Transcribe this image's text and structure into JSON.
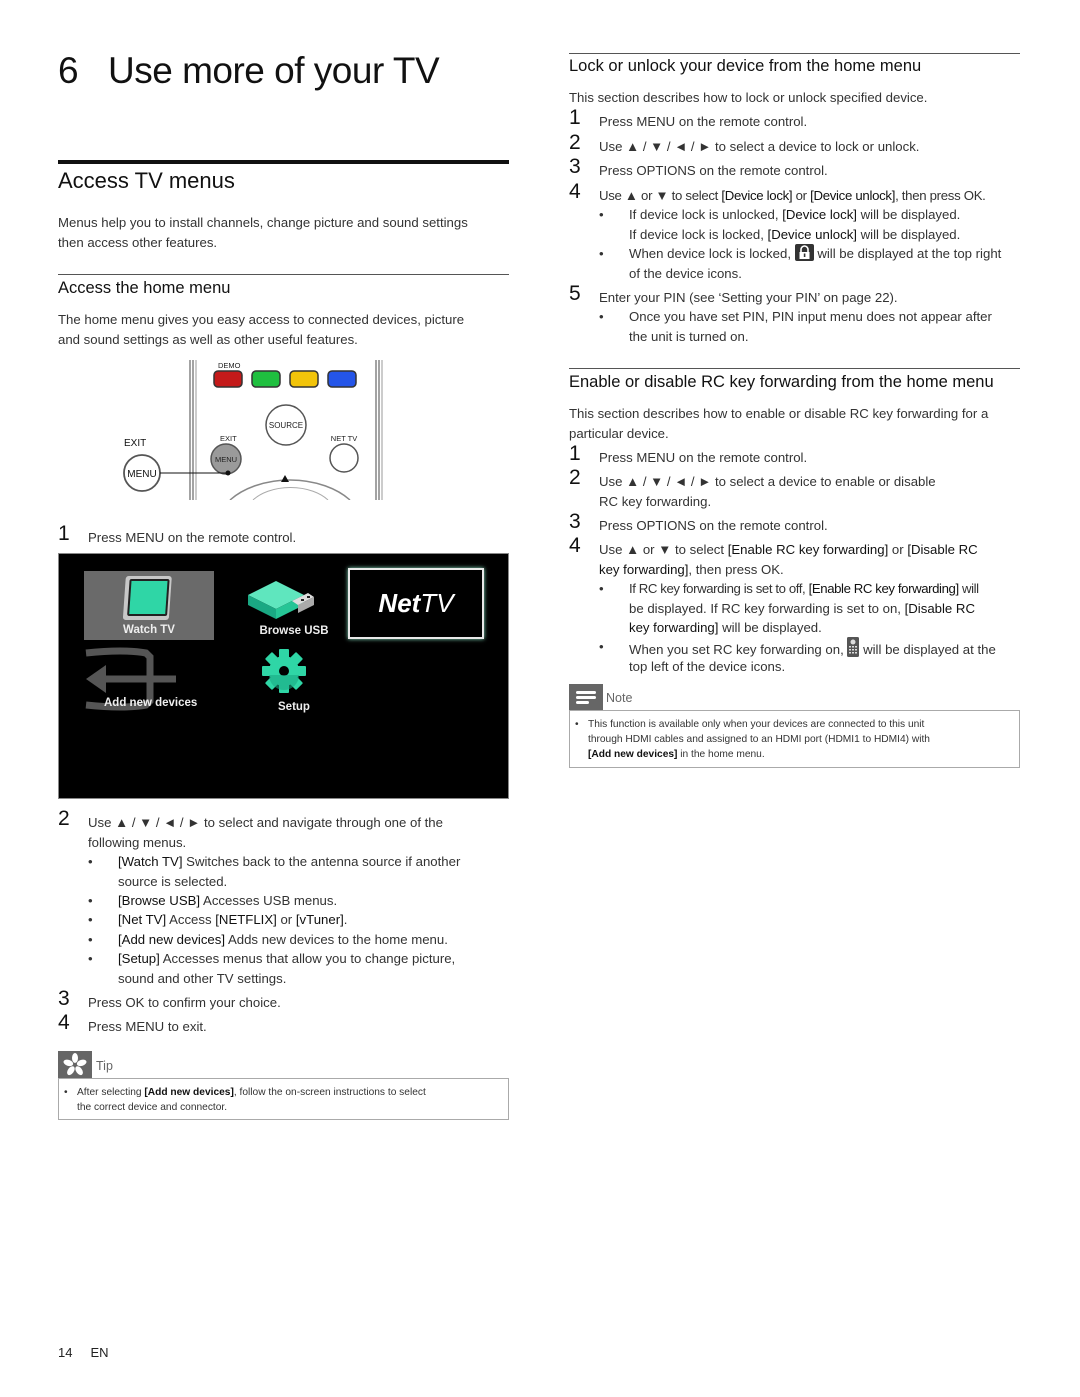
{
  "chapter": {
    "number": "6",
    "title": "Use more of your TV"
  },
  "access_tv_menus": {
    "heading": "Access TV menus",
    "intro": [
      "Menus help you to install channels, change picture and sound settings",
      "then access other features."
    ]
  },
  "access_home_menu": {
    "heading": "Access the home menu",
    "intro": [
      "The home menu gives you easy access to connected devices, picture",
      "and sound settings as well as other useful features."
    ],
    "remote_labels": {
      "demo": "DEMO",
      "source": "SOURCE",
      "exit_small": "EXIT",
      "menu_small": "MENU",
      "net_tv": "NET TV",
      "exit_large": "EXIT",
      "menu_large": "MENU"
    },
    "step1": {
      "num": "1",
      "text": "Press MENU on the remote control."
    },
    "home_screen": {
      "tiles": [
        {
          "label": "Watch TV",
          "icon": "tv-icon",
          "selected": true
        },
        {
          "label": "Browse USB",
          "icon": "usb-icon"
        },
        {
          "label": "NetTV",
          "icon": "nettv-logo"
        },
        {
          "label": "Add new devices",
          "icon": "add-device-icon"
        },
        {
          "label": "Setup",
          "icon": "gear-icon"
        }
      ],
      "nettv_logo": {
        "bold": "Net",
        "light": "TV"
      }
    },
    "step2": {
      "num": "2",
      "lines": [
        "Use ▲ / ▼ / ◄ / ► to select and navigate through one of the",
        "following menus."
      ],
      "bullets": [
        {
          "bold": "[Watch TV]",
          "text": " Switches back to the antenna source if another",
          "cont": "source is selected."
        },
        {
          "bold": "[Browse USB]",
          "text": " Accesses USB menus."
        },
        {
          "bold": "[Net TV]",
          "text": " Access ",
          "bold2": "[NETFLIX]",
          "text2": " or ",
          "bold3": "[vTuner]",
          "text3": "."
        },
        {
          "bold": "[Add new devices]",
          "text": " Adds new devices to the home menu."
        },
        {
          "bold": "[Setup]",
          "text": " Accesses menus that allow you to change picture,",
          "cont": "sound and other TV settings."
        }
      ]
    },
    "step3": {
      "num": "3",
      "text": "Press OK to confirm your choice."
    },
    "step4": {
      "num": "4",
      "text": "Press MENU to exit."
    },
    "tip": {
      "label": "Tip",
      "pre": "After selecting ",
      "bold": "[Add new devices]",
      "post": ", follow the on-screen instructions to select",
      "line2": "the correct device and connector."
    }
  },
  "lock_section": {
    "heading": "Lock or unlock your device from the home menu",
    "intro": "This section describes how to lock or unlock specified device.",
    "steps": [
      {
        "num": "1",
        "text": "Press MENU on the remote control."
      },
      {
        "num": "2",
        "text": "Use ▲ / ▼ / ◄ / ► to select a device to lock or unlock."
      },
      {
        "num": "3",
        "text": "Press OPTIONS on the remote control."
      },
      {
        "num": "4",
        "pre": "Use ▲ or ▼ to select ",
        "b1": "[Device lock]",
        "mid": " or ",
        "b2": "[Device unlock]",
        "post": ", then press OK."
      },
      {
        "num": "5",
        "text": "Enter your PIN (see ‘Setting your PIN’ on page 22)."
      }
    ],
    "step4_bullets": {
      "b1_pre": "If device lock is unlocked, ",
      "b1_bold": "[Device lock]",
      "b1_post": " will be displayed.",
      "b1_l2_pre": "If device lock is locked, ",
      "b1_l2_bold": "[Device unlock]",
      "b1_l2_post": " will be displayed.",
      "b2_pre": "When device lock is locked, ",
      "b2_post": " will be displayed at the top right",
      "b2_cont": "of the device icons."
    },
    "step5_bullet": {
      "line1": "Once you have set PIN, PIN input menu does not appear after",
      "line2": "the unit is turned on."
    }
  },
  "rc_section": {
    "heading": "Enable or disable RC key forwarding from the home menu",
    "intro": [
      "This section describes how to enable or disable RC key forwarding for a",
      "particular device."
    ],
    "steps": [
      {
        "num": "1",
        "text": "Press MENU on the remote control."
      },
      {
        "num": "2",
        "text": "Use ▲ / ▼ / ◄ / ► to select a device to enable or disable",
        "cont": "RC key forwarding."
      },
      {
        "num": "3",
        "text": "Press OPTIONS on the remote control."
      },
      {
        "num": "4",
        "pre": "Use ▲ or ▼ to select ",
        "b1": "[Enable RC key forwarding]",
        "mid": " or ",
        "b2": "[Disable RC",
        "cont_bold": "key forwarding]",
        "cont_post": ", then press OK."
      }
    ],
    "bullets": {
      "b1_pre": "If RC key forwarding is set to off, ",
      "b1_bold": "[Enable RC key forwarding]",
      "b1_post": " will",
      "b1_l2_pre": "be displayed. If RC key forwarding is set to on, ",
      "b1_l2_bold": "[Disable RC",
      "b1_l3_bold": "key forwarding]",
      "b1_l3_post": " will be displayed.",
      "b2_pre": "When you set RC key forwarding on, ",
      "b2_post": " will be displayed at the",
      "b2_cont": "top left of the device icons."
    },
    "note": {
      "label": "Note",
      "line1": "This function is available only when your devices are connected to this unit",
      "line2": "through HDMI cables and assigned to an HDMI port (HDMI1 to HDMI4) with",
      "line3_bold": "[Add new devices]",
      "line3_post": " in the home menu."
    }
  },
  "footer": {
    "page": "14",
    "lang": "EN"
  },
  "colors": {
    "accent_teal": "#2fd6a6",
    "red": "#c41a1a",
    "green": "#1fbf3f",
    "yellow": "#f2c40a",
    "blue": "#2455e8"
  }
}
